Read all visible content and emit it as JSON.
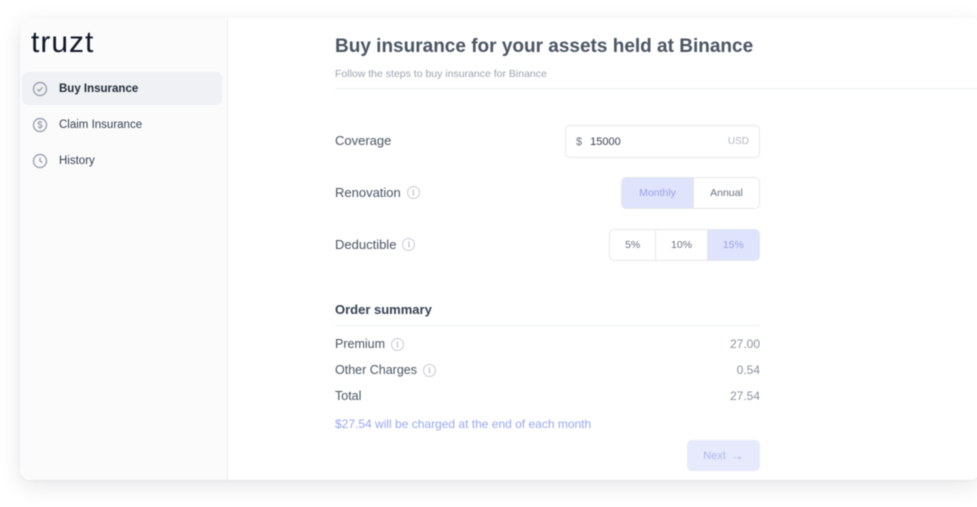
{
  "app": {
    "logo_text": "truzt"
  },
  "sidebar": {
    "items": [
      {
        "label": "Buy Insurance",
        "icon": "shield-check-icon",
        "active": true
      },
      {
        "label": "Claim Insurance",
        "icon": "dollar-circle-icon",
        "active": false
      },
      {
        "label": "History",
        "icon": "clock-icon",
        "active": false
      }
    ]
  },
  "header": {
    "title": "Buy insurance for your assets held at Binance",
    "subtitle": "Follow the steps to buy insurance for Binance"
  },
  "form": {
    "coverage": {
      "label": "Coverage",
      "prefix": "$",
      "value": "15000",
      "suffix": "USD"
    },
    "renovation": {
      "label": "Renovation",
      "options": [
        "Monthly",
        "Annual"
      ],
      "selected": "Monthly"
    },
    "deductible": {
      "label": "Deductible",
      "options": [
        "5%",
        "10%",
        "15%"
      ],
      "selected": "15%"
    }
  },
  "summary": {
    "title": "Order summary",
    "premium": {
      "label": "Premium",
      "value": "27.00"
    },
    "other_charges": {
      "label": "Other Charges",
      "value": "0.54"
    },
    "total": {
      "label": "Total",
      "value": "27.54"
    },
    "note": "$27.54 will be charged at the end of each month"
  },
  "actions": {
    "next_label": "Next",
    "next_arrow": "→"
  },
  "colors": {
    "accent": "#dfe3fb",
    "accent_text": "#98a8f0"
  }
}
